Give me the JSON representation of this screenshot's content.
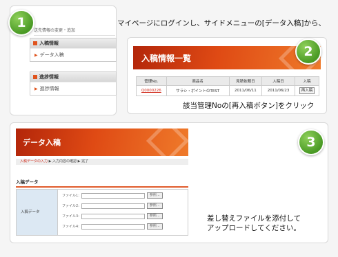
{
  "steps": {
    "step1": {
      "number": "1",
      "instruction": "マイページにログインし、サイドメニューの[データ入稿]から、"
    },
    "step2": {
      "number": "2",
      "instruction": "該当管理Noの[再入稿ボタン]をクリック"
    },
    "step3": {
      "number": "3",
      "instruction_line1": "差し替えファイルを添付して",
      "instruction_line2": "アップロードしてください。"
    }
  },
  "sidebar": {
    "top_item": "送先情報の変更・追加",
    "sections": [
      {
        "title": "入稿情報",
        "items": [
          "データ入稿"
        ]
      },
      {
        "title": "進捗情報",
        "items": [
          "進捗情報"
        ]
      }
    ]
  },
  "panel2": {
    "title": "入稿情報一覧",
    "columns": [
      "管理No.",
      "商品名",
      "見積依頼日",
      "入稿日",
      "入稿"
    ],
    "rows": [
      {
        "id": "Q0000226",
        "product": "サラシ・ポイントのTEST",
        "quote_date": "2011/06/11",
        "submit_date": "2011/06/23",
        "action": "再入稿"
      }
    ]
  },
  "panel3": {
    "title": "データ入稿",
    "breadcrumb": {
      "current": "入稿データの入力",
      "step2": "入力内容の確認",
      "step3": "完了"
    },
    "section_title": "入稿データ",
    "form_label": "入稿データ",
    "file_rows": [
      {
        "label": "ファイル1",
        "button": "参照..."
      },
      {
        "label": "ファイル2",
        "button": "参照..."
      },
      {
        "label": "ファイル3",
        "button": "参照..."
      },
      {
        "label": "ファイル4",
        "button": "参照..."
      }
    ]
  }
}
